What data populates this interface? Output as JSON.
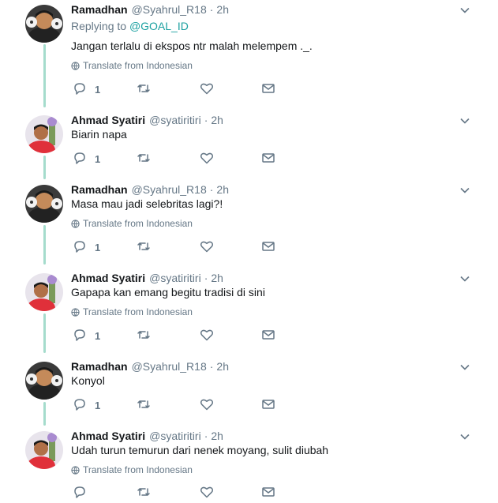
{
  "labels": {
    "replying_to": "Replying to",
    "translate": "Translate from Indonesian"
  },
  "colors": {
    "thread_line": "#a5dccc",
    "mention": "#1da1a1",
    "secondary_text": "#657786",
    "primary_text": "#14171a"
  },
  "tweets": [
    {
      "name": "Ramadhan",
      "handle": "@Syahrul_R18",
      "dot": "·",
      "time": "2h",
      "reply_to": "@GOAL_ID",
      "text": "Jangan terlalu di ekspos ntr malah melempem ._.",
      "translate": true,
      "reply_count": "1",
      "avatar": "ramadhan-avatar"
    },
    {
      "name": "Ahmad Syatiri",
      "handle": "@syatiritiri",
      "dot": "·",
      "time": "2h",
      "text": "Biarin napa",
      "translate": false,
      "reply_count": "1",
      "avatar": "ahmad-avatar"
    },
    {
      "name": "Ramadhan",
      "handle": "@Syahrul_R18",
      "dot": "·",
      "time": "2h",
      "text": "Masa mau jadi selebritas lagi?!",
      "translate": true,
      "reply_count": "1",
      "avatar": "ramadhan-avatar"
    },
    {
      "name": "Ahmad Syatiri",
      "handle": "@syatiritiri",
      "dot": "·",
      "time": "2h",
      "text": "Gapapa kan emang begitu tradisi di sini",
      "translate": true,
      "reply_count": "1",
      "avatar": "ahmad-avatar"
    },
    {
      "name": "Ramadhan",
      "handle": "@Syahrul_R18",
      "dot": "·",
      "time": "2h",
      "text": "Konyol",
      "translate": false,
      "reply_count": "1",
      "avatar": "ramadhan-avatar"
    },
    {
      "name": "Ahmad Syatiri",
      "handle": "@syatiritiri",
      "dot": "·",
      "time": "2h",
      "text": "Udah turun temurun dari nenek moyang,  sulit diubah",
      "translate": true,
      "reply_count": "",
      "avatar": "ahmad-avatar"
    }
  ]
}
